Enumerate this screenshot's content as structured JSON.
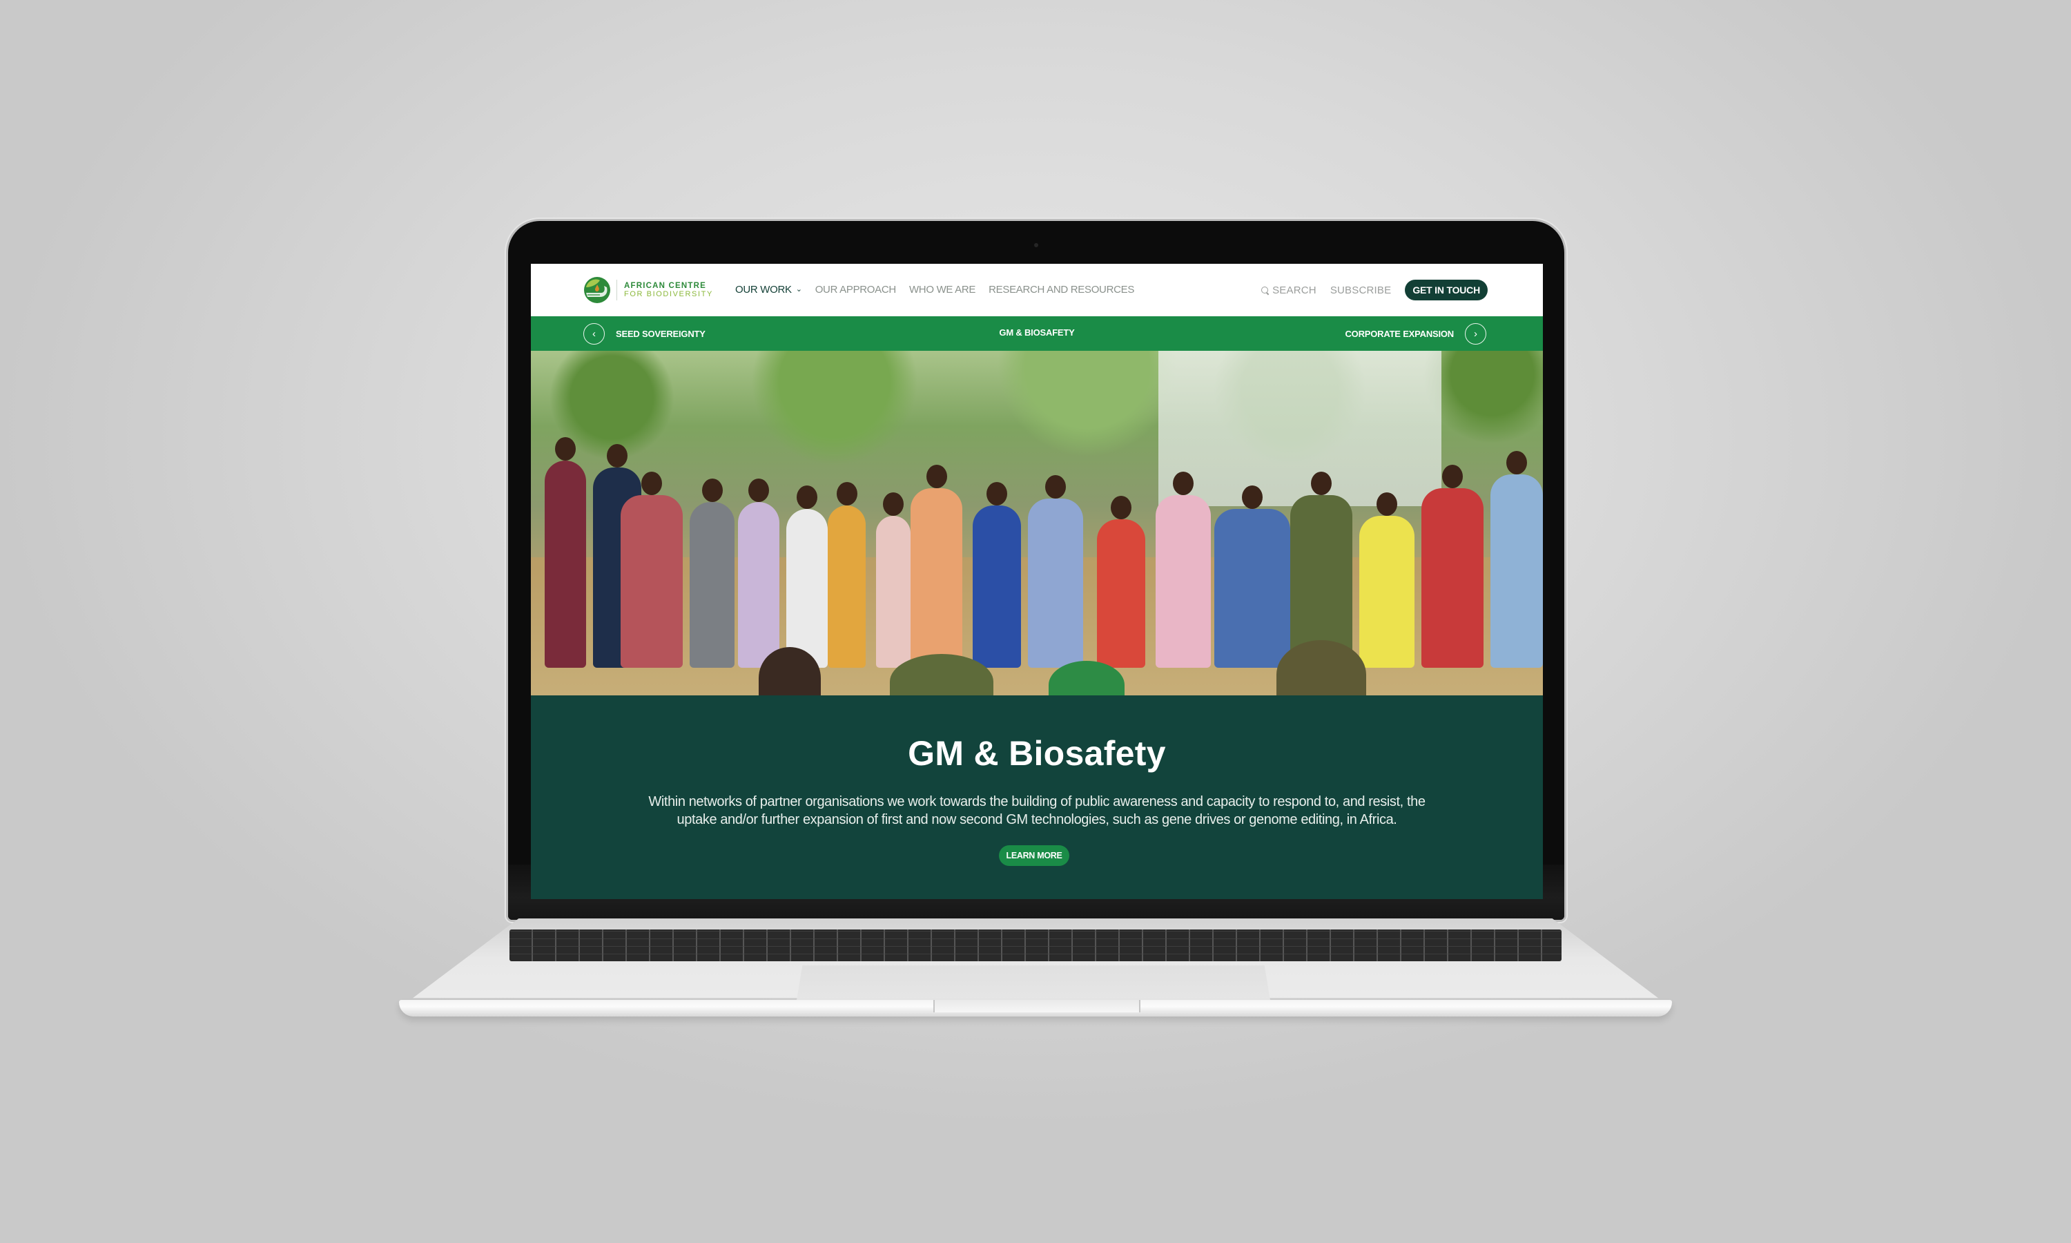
{
  "device": {
    "model_label": "MacBook Air"
  },
  "site": {
    "logo": {
      "line1": "AFRICAN CENTRE",
      "line2": "FOR BIODIVERSITY",
      "colors": {
        "primary": "#2d8a3a",
        "secondary": "#8bb83b",
        "accent": "#d8892b"
      }
    },
    "nav": {
      "items": [
        {
          "label": "OUR WORK",
          "active": true,
          "has_dropdown": true
        },
        {
          "label": "OUR APPROACH",
          "active": false
        },
        {
          "label": "WHO WE ARE",
          "active": false
        },
        {
          "label": "RESEARCH AND RESOURCES",
          "active": false
        }
      ]
    },
    "header_right": {
      "search_label": "SEARCH",
      "subscribe_label": "SUBSCRIBE",
      "cta_label": "GET IN TOUCH"
    },
    "subnav": {
      "prev_label": "SEED SOVEREIGNTY",
      "current_label": "GM & BIOSAFETY",
      "next_label": "CORPORATE EXPANSION",
      "prev_icon": "chevron-left-icon",
      "next_icon": "chevron-right-icon"
    },
    "hero": {
      "image_alt": "Group of farmers standing in a circle outdoors under trees",
      "title": "GM & Biosafety",
      "description": "Within networks of partner organisations we work towards the building of public awareness and capacity to respond to, and resist, the uptake and/or further expansion of first and now second GM technologies, such as gene drives or genome editing, in Africa.",
      "button_label": "LEARN MORE"
    },
    "colors": {
      "brand_dark": "#123f35",
      "brand_green": "#1a8c47",
      "hero_bg": "#12443c",
      "nav_inactive": "#8a918c"
    }
  }
}
